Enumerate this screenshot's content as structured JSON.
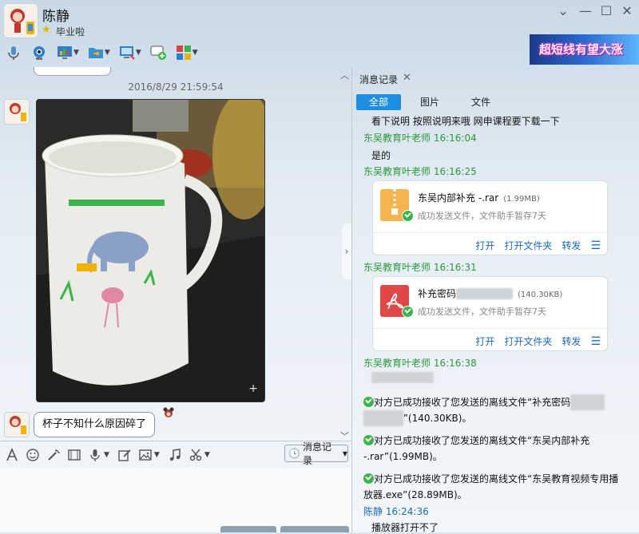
{
  "window": {
    "contact_name": "陈静",
    "signature": "毕业啦",
    "controls": [
      "chevron-down",
      "minimize",
      "maximize",
      "close"
    ]
  },
  "toolbar": {
    "icons": [
      "microphone-icon",
      "video-call-icon",
      "screen-share-icon",
      "file-transfer-icon",
      "remote-desktop-icon",
      "add-chat-icon",
      "apps-icon"
    ]
  },
  "ad": {
    "text": "超短线有望大涨"
  },
  "chat": {
    "timestamp": "2016/8/29 21:59:54",
    "message_text": "杯子不知什么原因碎了"
  },
  "input_toolbar": {
    "history_button_label": "消息记录"
  },
  "history": {
    "title": "消息记录",
    "tabs": [
      {
        "label": "全部",
        "active": true
      },
      {
        "label": "图片",
        "active": false
      },
      {
        "label": "文件",
        "active": false
      }
    ],
    "line1": "看下说明 按照说明来哦 网申课程要下载一下",
    "sender1": "东吴教育叶老师 16:16:04",
    "line2": "是的",
    "sender2": "东吴教育叶老师 16:16:25",
    "file1": {
      "name": "东吴内部补充 -.rar",
      "size": "(1.99MB)",
      "status": "成功发送文件，文件助手暂存7天",
      "actions": [
        "打开",
        "打开文件夹",
        "转发"
      ]
    },
    "sender3": "东吴教育叶老师 16:16:31",
    "file2": {
      "name": "补充密码",
      "size": "(140.30KB)",
      "status": "成功发送文件，文件助手暂存7天",
      "actions": [
        "打开",
        "打开文件夹",
        "转发"
      ]
    },
    "sender4": "东吴教育叶老师 16:16:38",
    "notice1_a": "对方已成功接收了您发送的离线文件“补充密码",
    "notice1_b": "”(140.30KB)。",
    "notice2": "对方已成功接收了您发送的离线文件“东吴内部补充 -.rar”(1.99MB)。",
    "notice3": "对方已成功接收了您发送的离线文件“东吴教育视频专用播放器.exe”(28.89MB)。",
    "sender5": "陈静  16:24:36",
    "line_last": "播放器打开不了"
  }
}
